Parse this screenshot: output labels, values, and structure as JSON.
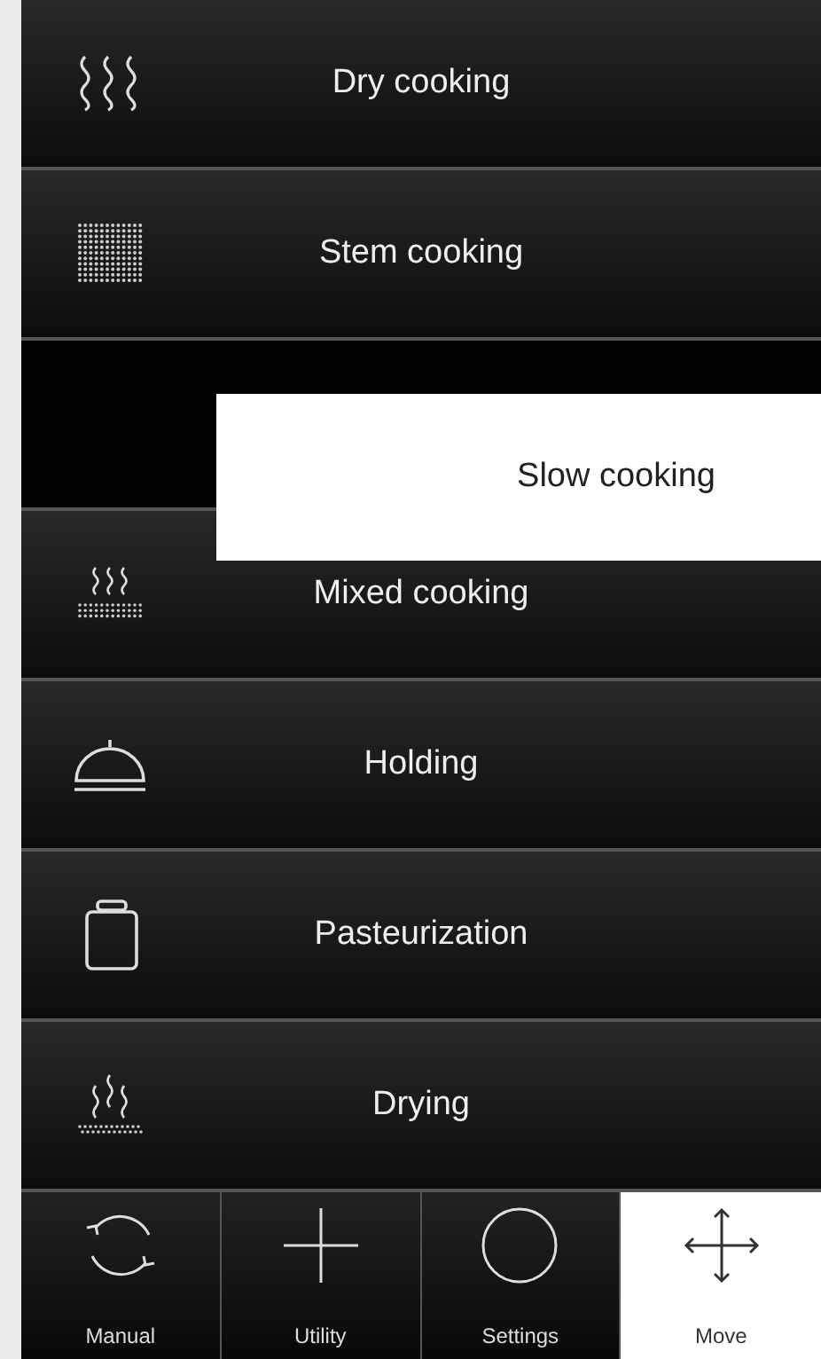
{
  "modes": [
    {
      "kind": "item",
      "label": "Dry cooking"
    },
    {
      "kind": "item",
      "label": "Stem cooking"
    },
    {
      "kind": "slot"
    },
    {
      "kind": "item",
      "label": "Mixed cooking"
    },
    {
      "kind": "item",
      "label": "Holding"
    },
    {
      "kind": "item",
      "label": "Pasteurization"
    },
    {
      "kind": "item",
      "label": "Drying"
    }
  ],
  "dragged_item": {
    "label": "Slow cooking"
  },
  "tabs": [
    {
      "label": "Manual",
      "selected": false
    },
    {
      "label": "Utility",
      "selected": false
    },
    {
      "label": "Settings",
      "selected": false
    },
    {
      "label": "Move",
      "selected": true
    }
  ]
}
